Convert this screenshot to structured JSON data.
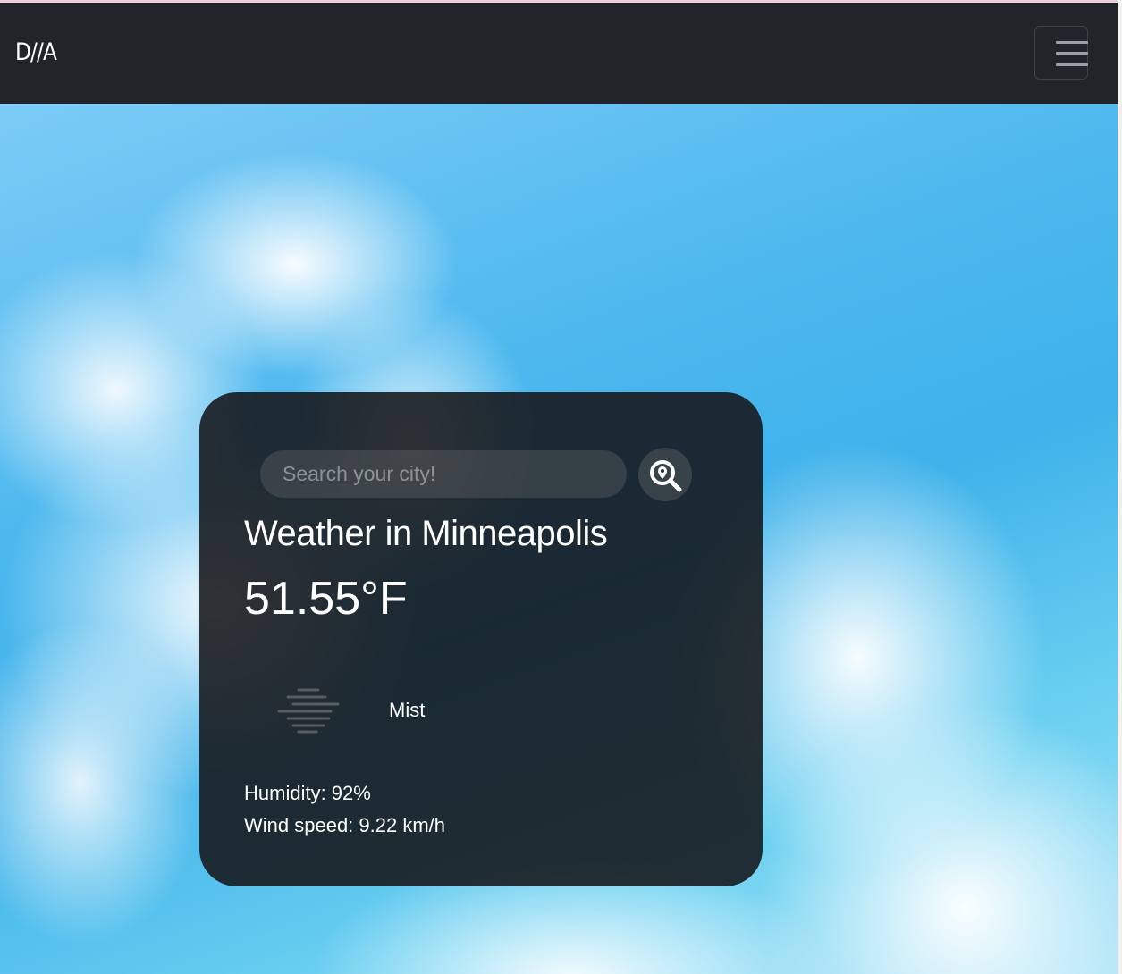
{
  "navbar": {
    "brand": "D//A",
    "menu_icon": "hamburger-menu-icon"
  },
  "search": {
    "placeholder": "Search your city!",
    "value": "",
    "button_icon": "search-location-icon"
  },
  "weather": {
    "title": "Weather in Minneapolis",
    "temperature": "51.55°F",
    "condition_icon": "mist-icon",
    "description": "Mist",
    "humidity": "Humidity: 92%",
    "wind_speed": "Wind speed: 9.22 km/h"
  },
  "colors": {
    "navbar_bg": "#212529",
    "card_bg": "#141619",
    "text": "#ffffff",
    "sky": "#4cb8ee"
  }
}
